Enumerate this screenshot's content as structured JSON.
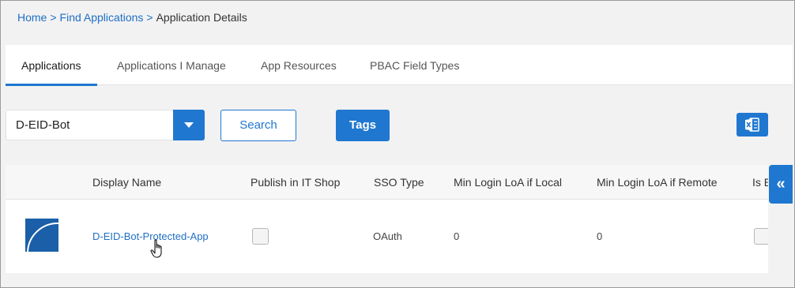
{
  "breadcrumb": {
    "home": "Home",
    "sep1": ">",
    "find_apps": "Find Applications",
    "sep2": ">",
    "current": "Application Details"
  },
  "tabs": [
    {
      "label": "Applications",
      "active": true
    },
    {
      "label": "Applications I Manage",
      "active": false
    },
    {
      "label": "App Resources",
      "active": false
    },
    {
      "label": "PBAC Field Types",
      "active": false
    }
  ],
  "filter": {
    "selected_value": "D-EID-Bot",
    "search_label": "Search",
    "tags_label": "Tags",
    "export_icon": "excel-icon"
  },
  "table": {
    "columns": [
      "Display Name",
      "Publish in IT Shop",
      "SSO Type",
      "Min Login LoA if Local",
      "Min Login LoA if Remote",
      "Is E"
    ],
    "rows": [
      {
        "display_name": "D-EID-Bot-Protected-App",
        "publish_in_it_shop": false,
        "sso_type": "OAuth",
        "min_login_loa_local": "0",
        "min_login_loa_remote": "0"
      }
    ]
  },
  "collapse_icon": "«",
  "colors": {
    "accent": "#1f77d0",
    "link": "#1f6fc5",
    "background": "#f2f2f2"
  }
}
